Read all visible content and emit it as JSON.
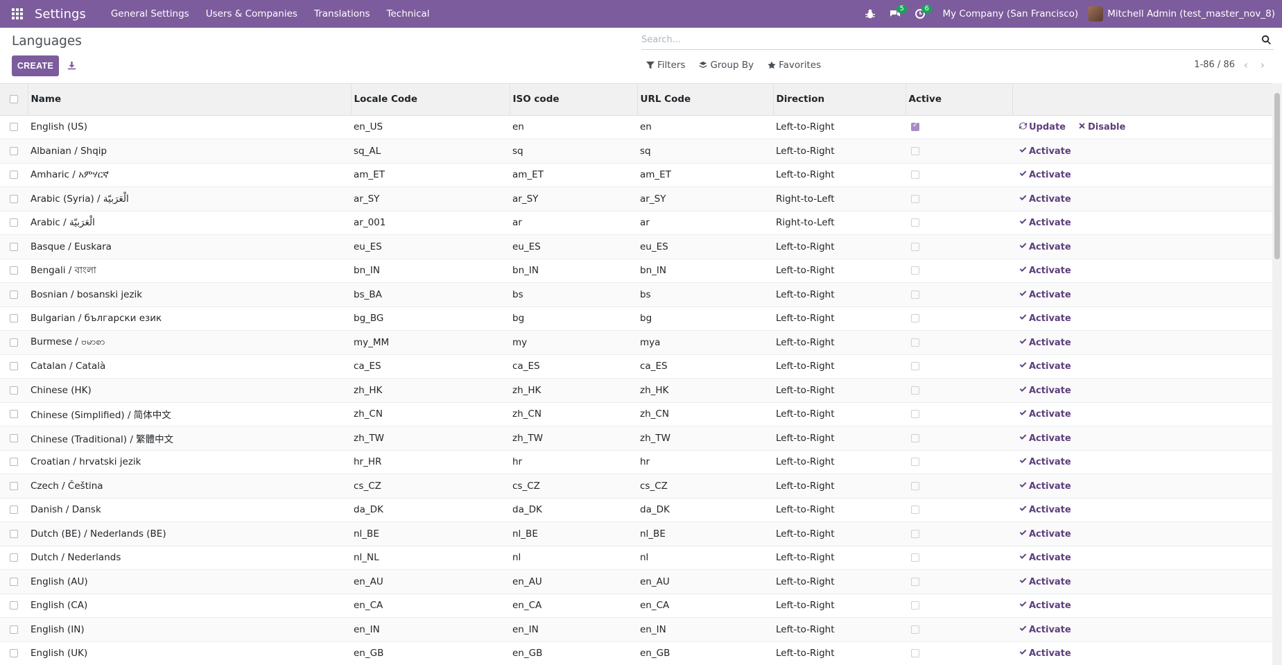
{
  "navbar": {
    "app_title": "Settings",
    "menu": [
      "General Settings",
      "Users & Companies",
      "Translations",
      "Technical"
    ],
    "messages_badge": "5",
    "activities_badge": "6",
    "company": "My Company (San Francisco)",
    "user": "Mitchell Admin (test_master_nov_8)"
  },
  "control_panel": {
    "title": "Languages",
    "create_label": "CREATE",
    "search_placeholder": "Search...",
    "filters_label": "Filters",
    "groupby_label": "Group By",
    "favorites_label": "Favorites",
    "pager": "1-86 / 86"
  },
  "table": {
    "headers": [
      "Name",
      "Locale Code",
      "ISO code",
      "URL Code",
      "Direction",
      "Active"
    ],
    "rows": [
      {
        "name": "English (US)",
        "locale": "en_US",
        "iso": "en",
        "url": "en",
        "direction": "Left-to-Right",
        "active": true
      },
      {
        "name": "Albanian / Shqip",
        "locale": "sq_AL",
        "iso": "sq",
        "url": "sq",
        "direction": "Left-to-Right",
        "active": false
      },
      {
        "name": "Amharic / አምሃርኛ",
        "locale": "am_ET",
        "iso": "am_ET",
        "url": "am_ET",
        "direction": "Left-to-Right",
        "active": false
      },
      {
        "name": "Arabic (Syria) / الْعَرَبيّة",
        "locale": "ar_SY",
        "iso": "ar_SY",
        "url": "ar_SY",
        "direction": "Right-to-Left",
        "active": false
      },
      {
        "name": "Arabic / الْعَرَبيّة",
        "locale": "ar_001",
        "iso": "ar",
        "url": "ar",
        "direction": "Right-to-Left",
        "active": false
      },
      {
        "name": "Basque / Euskara",
        "locale": "eu_ES",
        "iso": "eu_ES",
        "url": "eu_ES",
        "direction": "Left-to-Right",
        "active": false
      },
      {
        "name": "Bengali / বাংলা",
        "locale": "bn_IN",
        "iso": "bn_IN",
        "url": "bn_IN",
        "direction": "Left-to-Right",
        "active": false
      },
      {
        "name": "Bosnian / bosanski jezik",
        "locale": "bs_BA",
        "iso": "bs",
        "url": "bs",
        "direction": "Left-to-Right",
        "active": false
      },
      {
        "name": "Bulgarian / български език",
        "locale": "bg_BG",
        "iso": "bg",
        "url": "bg",
        "direction": "Left-to-Right",
        "active": false
      },
      {
        "name": "Burmese / ဗမာစာ",
        "locale": "my_MM",
        "iso": "my",
        "url": "mya",
        "direction": "Left-to-Right",
        "active": false
      },
      {
        "name": "Catalan / Català",
        "locale": "ca_ES",
        "iso": "ca_ES",
        "url": "ca_ES",
        "direction": "Left-to-Right",
        "active": false
      },
      {
        "name": "Chinese (HK)",
        "locale": "zh_HK",
        "iso": "zh_HK",
        "url": "zh_HK",
        "direction": "Left-to-Right",
        "active": false
      },
      {
        "name": "Chinese (Simplified) / 简体中文",
        "locale": "zh_CN",
        "iso": "zh_CN",
        "url": "zh_CN",
        "direction": "Left-to-Right",
        "active": false
      },
      {
        "name": "Chinese (Traditional) / 繁體中文",
        "locale": "zh_TW",
        "iso": "zh_TW",
        "url": "zh_TW",
        "direction": "Left-to-Right",
        "active": false
      },
      {
        "name": "Croatian / hrvatski jezik",
        "locale": "hr_HR",
        "iso": "hr",
        "url": "hr",
        "direction": "Left-to-Right",
        "active": false
      },
      {
        "name": "Czech / Čeština",
        "locale": "cs_CZ",
        "iso": "cs_CZ",
        "url": "cs_CZ",
        "direction": "Left-to-Right",
        "active": false
      },
      {
        "name": "Danish / Dansk",
        "locale": "da_DK",
        "iso": "da_DK",
        "url": "da_DK",
        "direction": "Left-to-Right",
        "active": false
      },
      {
        "name": "Dutch (BE) / Nederlands (BE)",
        "locale": "nl_BE",
        "iso": "nl_BE",
        "url": "nl_BE",
        "direction": "Left-to-Right",
        "active": false
      },
      {
        "name": "Dutch / Nederlands",
        "locale": "nl_NL",
        "iso": "nl",
        "url": "nl",
        "direction": "Left-to-Right",
        "active": false
      },
      {
        "name": "English (AU)",
        "locale": "en_AU",
        "iso": "en_AU",
        "url": "en_AU",
        "direction": "Left-to-Right",
        "active": false
      },
      {
        "name": "English (CA)",
        "locale": "en_CA",
        "iso": "en_CA",
        "url": "en_CA",
        "direction": "Left-to-Right",
        "active": false
      },
      {
        "name": "English (IN)",
        "locale": "en_IN",
        "iso": "en_IN",
        "url": "en_IN",
        "direction": "Left-to-Right",
        "active": false
      },
      {
        "name": "English (UK)",
        "locale": "en_GB",
        "iso": "en_GB",
        "url": "en_GB",
        "direction": "Left-to-Right",
        "active": false
      }
    ],
    "update_label": "Update",
    "disable_label": "Disable",
    "activate_label": "Activate"
  },
  "colors": {
    "brand": "#7c5c9c",
    "action": "#5c3f7c",
    "badge": "#1aa35a"
  }
}
